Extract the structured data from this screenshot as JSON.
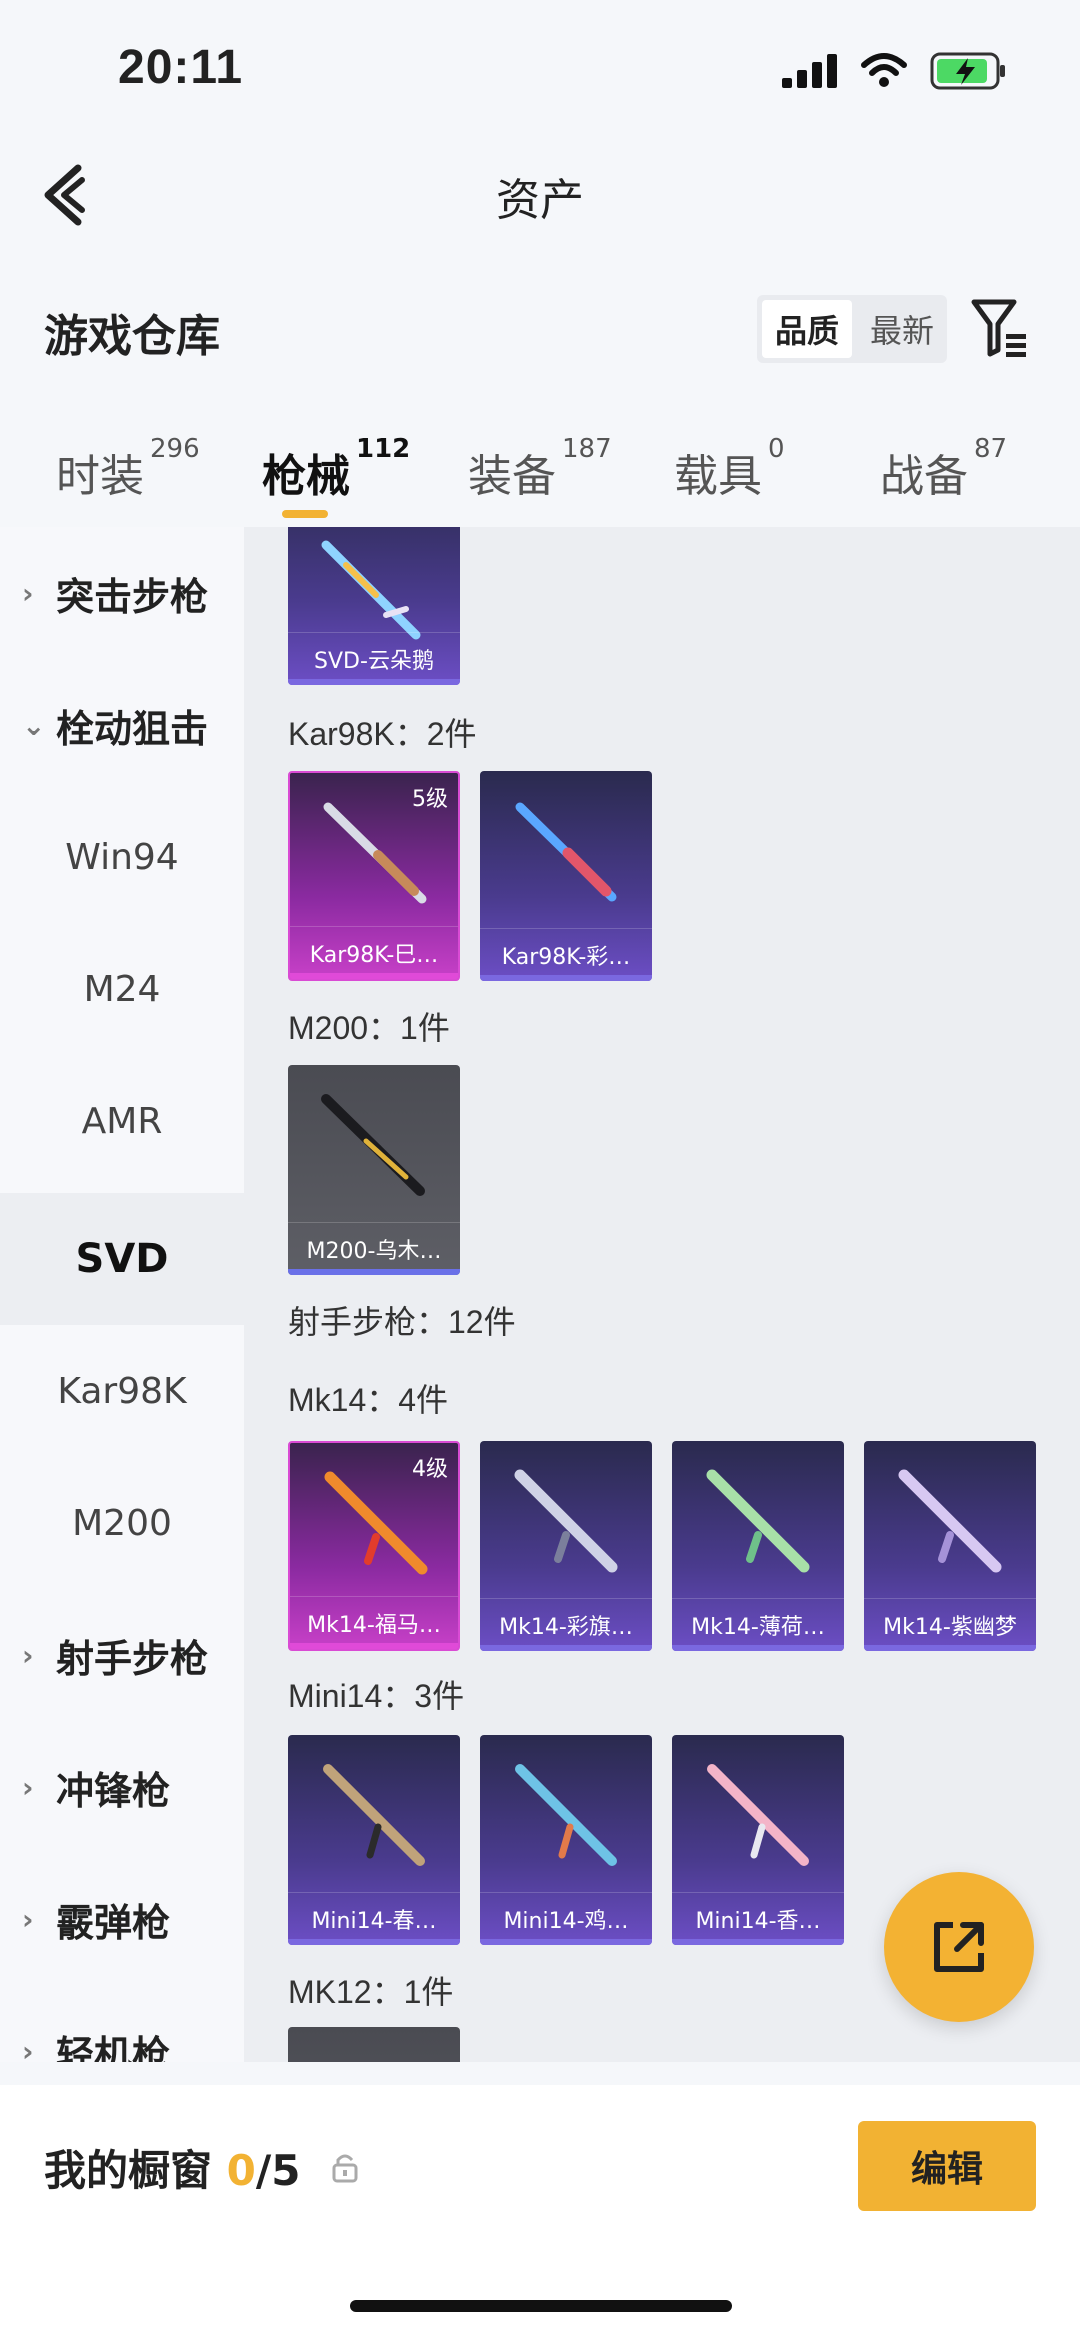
{
  "status": {
    "time": "20:11"
  },
  "header": {
    "title": "资产"
  },
  "warehouse": {
    "title": "游戏仓库",
    "sort_options": [
      "品质",
      "最新"
    ]
  },
  "tabs": [
    {
      "label": "时装",
      "count": "296"
    },
    {
      "label": "枪械",
      "count": "112"
    },
    {
      "label": "装备",
      "count": "187"
    },
    {
      "label": "载具",
      "count": "0"
    },
    {
      "label": "战备",
      "count": "87"
    }
  ],
  "sidebar": {
    "items": [
      {
        "label": "突击步枪",
        "chev": "›"
      },
      {
        "label": "栓动狙击",
        "chev": "⌄"
      },
      {
        "label": "Win94"
      },
      {
        "label": "M24"
      },
      {
        "label": "AMR"
      },
      {
        "label": "SVD"
      },
      {
        "label": "Kar98K"
      },
      {
        "label": "M200"
      },
      {
        "label": "射手步枪",
        "chev": "›"
      },
      {
        "label": "冲锋枪",
        "chev": "›"
      },
      {
        "label": "霰弹枪",
        "chev": "›"
      },
      {
        "label": "轻机枪",
        "chev": "›"
      }
    ]
  },
  "content": {
    "svd_card": {
      "name": "SVD-云朵鹅"
    },
    "sections": [
      {
        "label": "Kar98K：2件"
      },
      {
        "label": "M200：1件"
      },
      {
        "label": "射手步枪：12件"
      },
      {
        "label": "Mk14：4件"
      },
      {
        "label": "Mini14：3件"
      },
      {
        "label": "MK12：1件"
      }
    ],
    "kar98k_cards": [
      {
        "name": "Kar98K-巳…",
        "level": "5级"
      },
      {
        "name": "Kar98K-彩…"
      }
    ],
    "m200_cards": [
      {
        "name": "M200-乌木…"
      }
    ],
    "mk14_cards": [
      {
        "name": "Mk14-福马…",
        "level": "4级"
      },
      {
        "name": "Mk14-彩旗…"
      },
      {
        "name": "Mk14-薄荷…"
      },
      {
        "name": "Mk14-紫幽梦"
      }
    ],
    "mini14_cards": [
      {
        "name": "Mini14-春…"
      },
      {
        "name": "Mini14-鸡…"
      },
      {
        "name": "Mini14-香…"
      }
    ]
  },
  "bottom": {
    "showcase_label": "我的橱窗",
    "showcase_count": "0",
    "showcase_total": "/5",
    "edit_label": "编辑"
  },
  "colors": {
    "accent": "#f2b233"
  }
}
